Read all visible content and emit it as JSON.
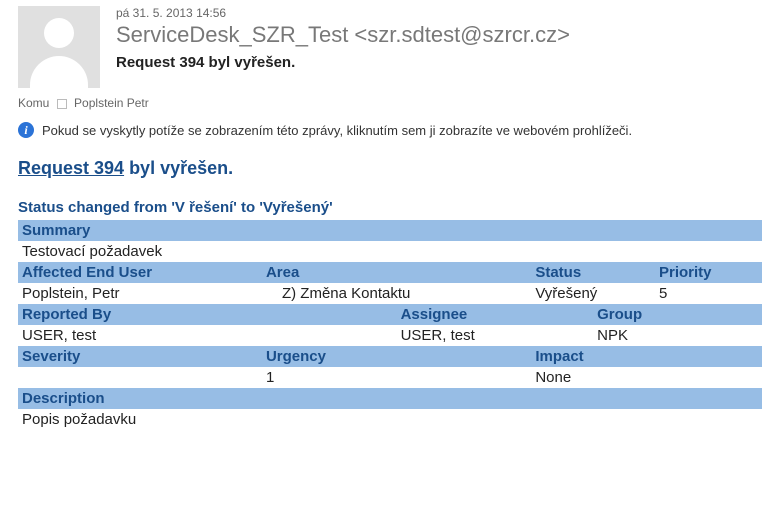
{
  "header": {
    "date": "pá 31. 5. 2013 14:56",
    "from": "ServiceDesk_SZR_Test <szr.sdtest@szrcr.cz>",
    "subject": "Request 394 byl vyřešen."
  },
  "to": {
    "label": "Komu",
    "recipient": "Poplstein Petr"
  },
  "info_bar": "Pokud se vyskytly potíže se zobrazením této zprávy, kliknutím sem ji zobrazíte ve webovém prohlížeči.",
  "body": {
    "title_link": "Request 394",
    "title_rest": " byl vyřešen.",
    "status_change": "Status changed from 'V řešení' to 'Vyřešený'",
    "labels": {
      "summary": "Summary",
      "affected_end_user": "Affected End User",
      "area": "Area",
      "status": "Status",
      "priority": "Priority",
      "reported_by": "Reported By",
      "assignee": "Assignee",
      "group": "Group",
      "severity": "Severity",
      "urgency": "Urgency",
      "impact": "Impact",
      "description": "Description"
    },
    "values": {
      "summary": "Testovací požadavek",
      "affected_end_user": "Poplstein, Petr",
      "area": "Z) Změna Kontaktu",
      "status": "Vyřešený",
      "priority": "5",
      "reported_by": "USER, test",
      "assignee": "USER, test",
      "group": "NPK",
      "severity": "",
      "urgency": "1",
      "impact": "None",
      "description": "Popis požadavku"
    }
  }
}
